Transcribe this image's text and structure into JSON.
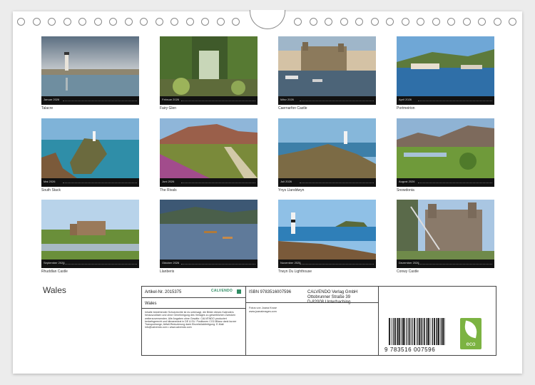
{
  "calendar": {
    "title": "Wales",
    "tiles": [
      {
        "month": "Januar 2026",
        "caption": "Talacre"
      },
      {
        "month": "Februar 2026",
        "caption": "Fairy Glen"
      },
      {
        "month": "März 2026",
        "caption": "Caernarfon Castle"
      },
      {
        "month": "April 2026",
        "caption": "Portmeirion"
      },
      {
        "month": "Mai 2026",
        "caption": "South Stack"
      },
      {
        "month": "Juni 2026",
        "caption": "The Rivals"
      },
      {
        "month": "Juli 2026",
        "caption": "Ynys Llanddwyn"
      },
      {
        "month": "August 2026",
        "caption": "Snowdonia"
      },
      {
        "month": "September 2026",
        "caption": "Rhuddlan Castle"
      },
      {
        "month": "Oktober 2026",
        "caption": "Llanberis"
      },
      {
        "month": "November 2026",
        "caption": "Trwyn Du Lighthouse"
      },
      {
        "month": "Dezember 2026",
        "caption": "Conwy Castle"
      }
    ]
  },
  "info": {
    "article": "Artikel-Nr. 2015375",
    "brand": "CALVENDO",
    "title": "Wales",
    "legal": "Inhalte bestehender Schutzrechte ist es untersagt, die Bilder dieses Kalenders herauszulösen und ohne Genehmigung des Verlages zu gewerblichen Zwecken weiterzuverwenden. Alle Angaben ohne Gewähr. CALVENDO produziert bedarfsgerecht und klimaneutral in DE & EU. Positionen CO2-Bilanz dank kurzer Transportwege, Abfall-Reduzierung dank Einzelstückfertigung. E-Mail: info@calvendo.com • www.calvendo.com",
    "isbn": "ISBN 9783516007596",
    "publisher": [
      "CALVENDO Verlag GmbH",
      "Ottobrunner Straße 39",
      "D-82008 Unterhaching"
    ],
    "photo_credit": [
      "Fotos von Joana Kruse",
      "www.joanaimages.com"
    ],
    "barcode_number": "9 783516 007596",
    "eco_label": "eco"
  }
}
